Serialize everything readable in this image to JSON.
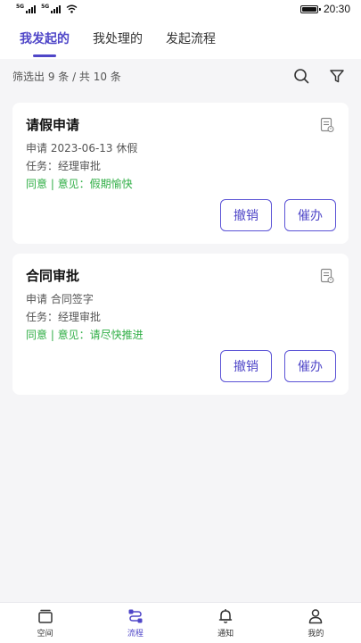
{
  "status_bar": {
    "signal_tags": [
      "5G",
      "5G"
    ],
    "time": "20:30"
  },
  "tabs": [
    {
      "label": "我发起的",
      "active": true
    },
    {
      "label": "我处理的",
      "active": false
    },
    {
      "label": "发起流程",
      "active": false
    }
  ],
  "filter": {
    "summary": "筛选出 9 条 / 共 10 条"
  },
  "cards": [
    {
      "title": "请假申请",
      "apply_line": "申请 2023-06-13 休假",
      "task_line": "任务：经理审批",
      "opinion_line": "同意 | 意见：假期愉快",
      "revoke_label": "撤销",
      "urge_label": "催办"
    },
    {
      "title": "合同审批",
      "apply_line": "申请 合同签字",
      "task_line": "任务：经理审批",
      "opinion_line": "同意 | 意见：请尽快推进",
      "revoke_label": "撤销",
      "urge_label": "催办"
    }
  ],
  "bottom_nav": [
    {
      "label": "空间",
      "icon": "space-icon",
      "active": false
    },
    {
      "label": "流程",
      "icon": "flow-icon",
      "active": true
    },
    {
      "label": "通知",
      "icon": "bell-icon",
      "active": false
    },
    {
      "label": "我的",
      "icon": "person-icon",
      "active": false
    }
  ],
  "colors": {
    "accent": "#4f46c8",
    "approve_green": "#2fae45",
    "background": "#f5f5f7"
  }
}
